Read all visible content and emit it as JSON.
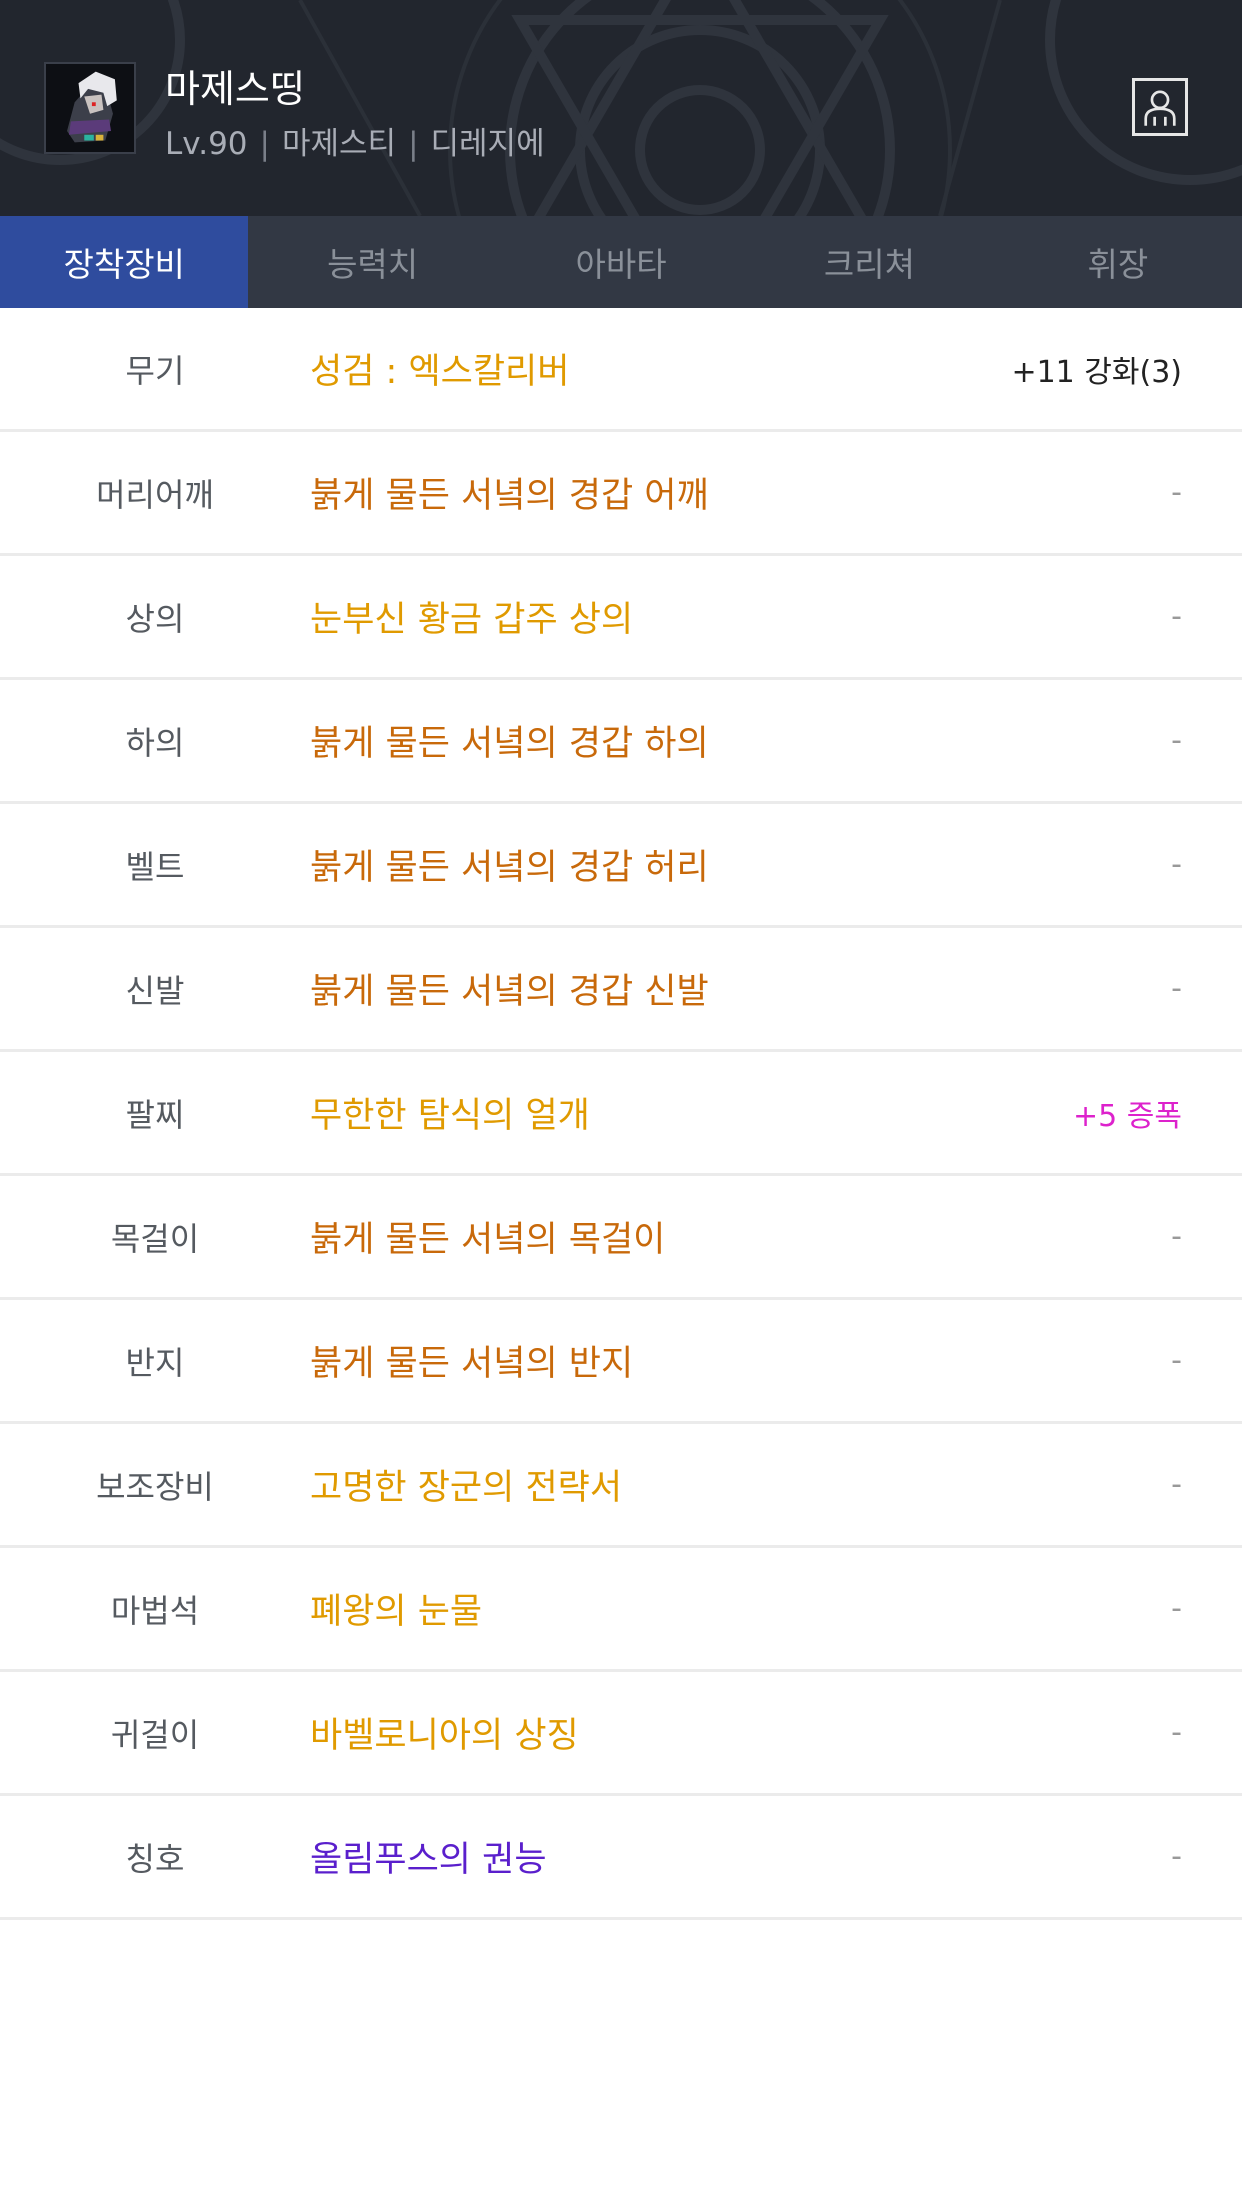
{
  "header": {
    "character_name": "마제스띵",
    "level": "Lv.90",
    "job": "마제스티",
    "server": "디레지에",
    "separator": "|",
    "avatar_icon": "character-portrait",
    "profile_icon": "person-icon"
  },
  "tabs": [
    {
      "label": "장착장비",
      "active": true
    },
    {
      "label": "능력치",
      "active": false
    },
    {
      "label": "아바타",
      "active": false
    },
    {
      "label": "크리쳐",
      "active": false
    },
    {
      "label": "휘장",
      "active": false
    }
  ],
  "colors": {
    "legendary": "#e09a00",
    "epic": "#c8690a",
    "unique": "#5a1fcc",
    "amplify": "#dd22cc",
    "active_tab": "#2f4c9e"
  },
  "equipment": [
    {
      "slot": "무기",
      "name": "성검 : 엑스칼리버",
      "extra": "+11 강화(3)",
      "color": "#e09a00",
      "extra_color": "#222222"
    },
    {
      "slot": "머리어깨",
      "name": "붉게 물든 서녘의 경갑 어깨",
      "extra": "-",
      "color": "#c8690a",
      "extra_color": "#999999"
    },
    {
      "slot": "상의",
      "name": "눈부신 황금 갑주 상의",
      "extra": "-",
      "color": "#e09a00",
      "extra_color": "#999999"
    },
    {
      "slot": "하의",
      "name": "붉게 물든 서녘의 경갑 하의",
      "extra": "-",
      "color": "#c8690a",
      "extra_color": "#999999"
    },
    {
      "slot": "벨트",
      "name": "붉게 물든 서녘의 경갑 허리",
      "extra": "-",
      "color": "#c8690a",
      "extra_color": "#999999"
    },
    {
      "slot": "신발",
      "name": "붉게 물든 서녘의 경갑 신발",
      "extra": "-",
      "color": "#c8690a",
      "extra_color": "#999999"
    },
    {
      "slot": "팔찌",
      "name": "무한한 탐식의 얼개",
      "extra": "+5 증폭",
      "color": "#e09a00",
      "extra_color": "#dd22cc"
    },
    {
      "slot": "목걸이",
      "name": "붉게 물든 서녘의 목걸이",
      "extra": "-",
      "color": "#c8690a",
      "extra_color": "#999999"
    },
    {
      "slot": "반지",
      "name": "붉게 물든 서녘의 반지",
      "extra": "-",
      "color": "#c8690a",
      "extra_color": "#999999"
    },
    {
      "slot": "보조장비",
      "name": "고명한 장군의 전략서",
      "extra": "-",
      "color": "#e09a00",
      "extra_color": "#999999"
    },
    {
      "slot": "마법석",
      "name": "폐왕의 눈물",
      "extra": "-",
      "color": "#e09a00",
      "extra_color": "#999999"
    },
    {
      "slot": "귀걸이",
      "name": "바벨로니아의 상징",
      "extra": "-",
      "color": "#e09a00",
      "extra_color": "#999999"
    },
    {
      "slot": "칭호",
      "name": "올림푸스의 권능",
      "extra": "-",
      "color": "#5a1fcc",
      "extra_color": "#999999"
    }
  ]
}
